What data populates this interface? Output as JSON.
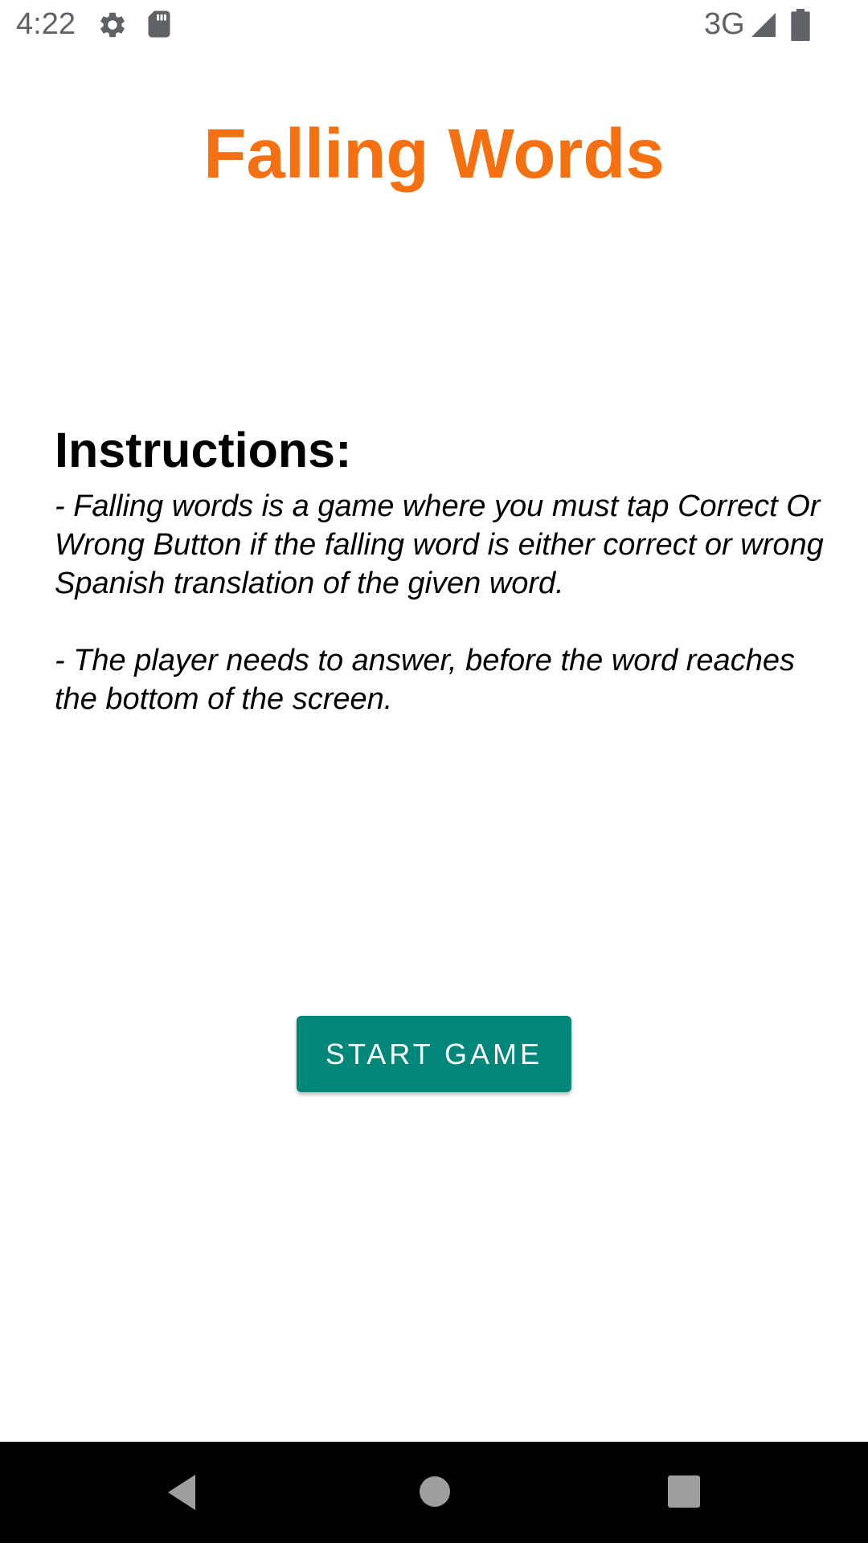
{
  "status_bar": {
    "time": "4:22",
    "network": "3G",
    "icons": [
      "gear-icon",
      "sd-card-icon",
      "signal-icon",
      "battery-icon"
    ]
  },
  "app": {
    "title": "Falling Words",
    "title_color": "#f57011"
  },
  "instructions": {
    "heading": "Instructions:",
    "paragraph_1": "- Falling words is a game where you must tap Correct Or Wrong Button if the falling word is either correct or wrong Spanish translation of the given word.",
    "paragraph_2": "- The player needs to answer, before the word reaches the bottom of the screen."
  },
  "start_button": {
    "label": "START GAME",
    "color": "#00877a"
  },
  "nav_bar": {
    "buttons": [
      "back-icon",
      "home-icon",
      "recents-icon"
    ]
  }
}
